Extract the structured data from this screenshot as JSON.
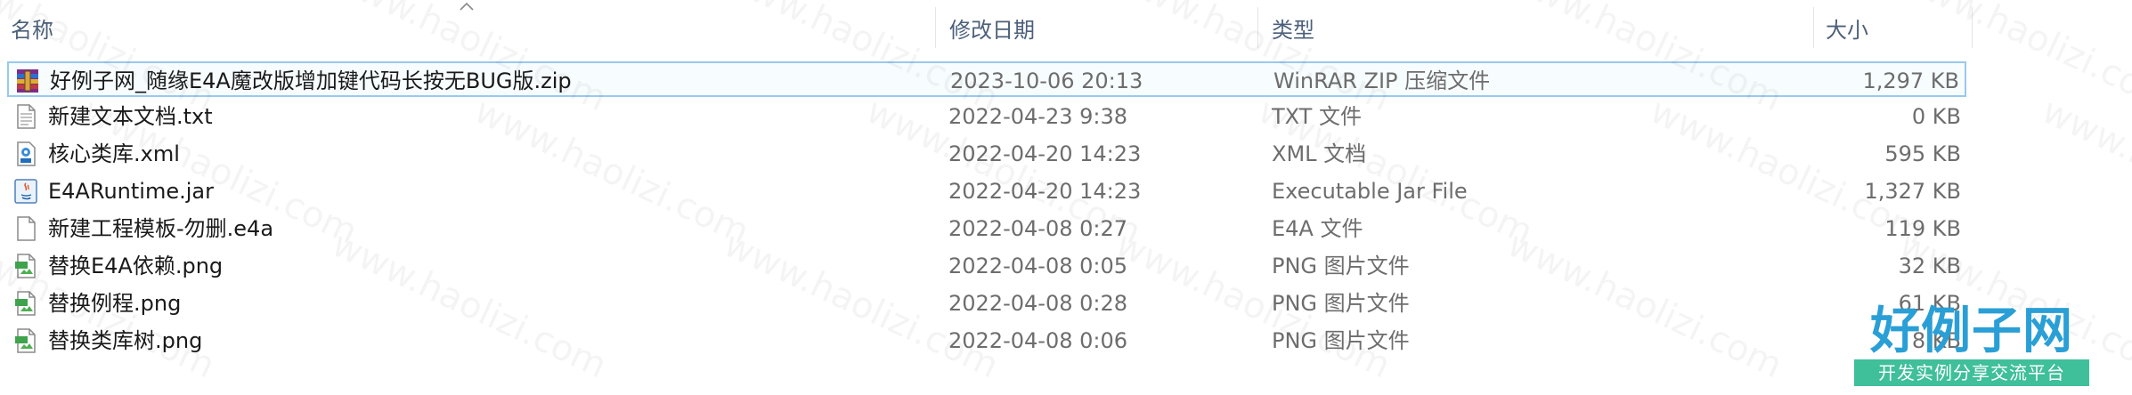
{
  "columns": {
    "name": "名称",
    "date": "修改日期",
    "type": "类型",
    "size": "大小"
  },
  "files": [
    {
      "icon": "winrar-archive-icon",
      "name": "好例子网_随缘E4A魔改版增加键代码长按无BUG版.zip",
      "date": "2023-10-06 20:13",
      "type": "WinRAR ZIP 压缩文件",
      "size": "1,297 KB",
      "selected": true
    },
    {
      "icon": "text-file-icon",
      "name": "新建文本文档.txt",
      "date": "2022-04-23 9:38",
      "type": "TXT 文件",
      "size": "0 KB"
    },
    {
      "icon": "xml-file-icon",
      "name": "核心类库.xml",
      "date": "2022-04-20 14:23",
      "type": "XML 文档",
      "size": "595 KB"
    },
    {
      "icon": "java-jar-icon",
      "name": "E4ARuntime.jar",
      "date": "2022-04-20 14:23",
      "type": "Executable Jar File",
      "size": "1,327 KB"
    },
    {
      "icon": "blank-file-icon",
      "name": "新建工程模板-勿删.e4a",
      "date": "2022-04-08 0:27",
      "type": "E4A 文件",
      "size": "119 KB"
    },
    {
      "icon": "png-image-icon",
      "name": "替换E4A依赖.png",
      "date": "2022-04-08 0:05",
      "type": "PNG 图片文件",
      "size": "32 KB"
    },
    {
      "icon": "png-image-icon",
      "name": "替换例程.png",
      "date": "2022-04-08 0:28",
      "type": "PNG 图片文件",
      "size": "61 KB"
    },
    {
      "icon": "png-image-icon",
      "name": "替换类库树.png",
      "date": "2022-04-08 0:06",
      "type": "PNG 图片文件",
      "size": "8 KB"
    }
  ],
  "watermark": "www.haolizi.com",
  "logo": {
    "title": "好例子网",
    "subtitle": "开发实例分享交流平台"
  },
  "colors": {
    "header_text": "#4c607a",
    "selection_border": "#99c9ef",
    "logo_blue": "#2a9fd6",
    "logo_green": "#3fbf9a"
  }
}
